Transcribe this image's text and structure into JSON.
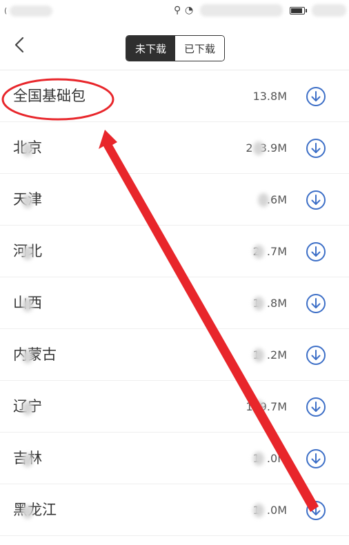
{
  "header": {
    "tabs": [
      {
        "label": "未下载",
        "active": true
      },
      {
        "label": "已下载",
        "active": false
      }
    ]
  },
  "icons": {
    "back": "chevron-left-icon",
    "download": "download-circle-icon",
    "wifi": "wifi-icon",
    "signal": "signal-icon",
    "battery": "battery-icon"
  },
  "colors": {
    "accent": "#3d6fc7",
    "segment_active": "#2f2f2f",
    "annotation": "#e8262b"
  },
  "packages": [
    {
      "name": "全国基础包",
      "size": "13.8M"
    },
    {
      "name": "北京",
      "size": "2  3.9M"
    },
    {
      "name": "天津",
      "size": "  .6M"
    },
    {
      "name": "河北",
      "size": "2  .7M"
    },
    {
      "name": "山西",
      "size": "1  .8M"
    },
    {
      "name": "内蒙古",
      "size": "1  .2M"
    },
    {
      "name": "辽宁",
      "size": "1  9.7M"
    },
    {
      "name": "吉林",
      "size": "1  .0M"
    },
    {
      "name": "黑龙江",
      "size": "1  .0M"
    }
  ]
}
